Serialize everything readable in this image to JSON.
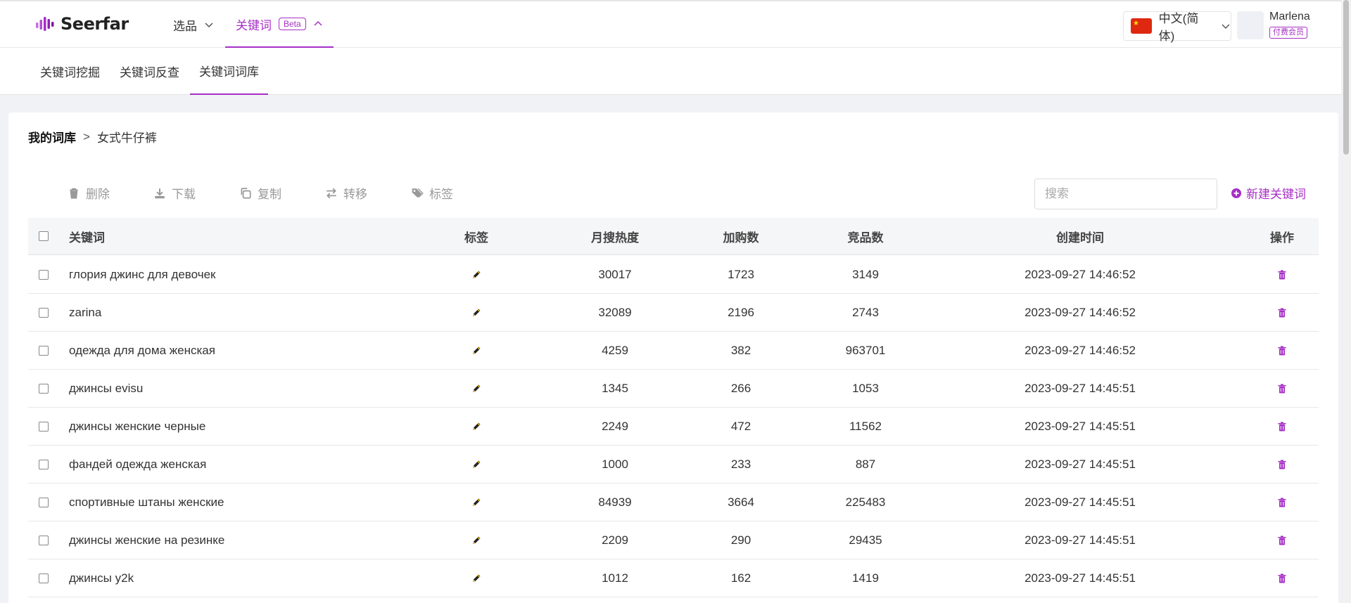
{
  "brand": {
    "name": "Seerfar",
    "accent": "#a62fc4"
  },
  "topnav": {
    "items": [
      {
        "label": "选品"
      },
      {
        "label": "关键词",
        "badge": "Beta"
      }
    ],
    "language": "中文(简体)",
    "user": {
      "name": "Marlena",
      "badge": "付费会员"
    }
  },
  "subnav": {
    "items": [
      {
        "label": "关键词挖掘"
      },
      {
        "label": "关键词反查"
      },
      {
        "label": "关键词词库"
      }
    ]
  },
  "breadcrumb": {
    "root": "我的词库",
    "separator": ">",
    "current": "女式牛仔裤"
  },
  "toolbar": {
    "delete": "删除",
    "download": "下载",
    "copy": "复制",
    "transfer": "转移",
    "tag": "标签",
    "search_placeholder": "搜索",
    "new_keyword": "新建关键词"
  },
  "table": {
    "headers": {
      "keyword": "关键词",
      "tags": "标签",
      "monthly_search": "月搜热度",
      "add_to_cart": "加购数",
      "competitors": "竞品数",
      "created": "创建时间",
      "actions": "操作"
    },
    "rows": [
      {
        "keyword": "глория джинс для девочек",
        "monthly_search": "30017",
        "add_to_cart": "1723",
        "competitors": "3149",
        "created": "2023-09-27 14:46:52"
      },
      {
        "keyword": "zarina",
        "monthly_search": "32089",
        "add_to_cart": "2196",
        "competitors": "2743",
        "created": "2023-09-27 14:46:52"
      },
      {
        "keyword": "одежда для дома женская",
        "monthly_search": "4259",
        "add_to_cart": "382",
        "competitors": "963701",
        "created": "2023-09-27 14:46:52"
      },
      {
        "keyword": "джинсы evisu",
        "monthly_search": "1345",
        "add_to_cart": "266",
        "competitors": "1053",
        "created": "2023-09-27 14:45:51"
      },
      {
        "keyword": "джинсы женские черные",
        "monthly_search": "2249",
        "add_to_cart": "472",
        "competitors": "11562",
        "created": "2023-09-27 14:45:51"
      },
      {
        "keyword": "фандей одежда женская",
        "monthly_search": "1000",
        "add_to_cart": "233",
        "competitors": "887",
        "created": "2023-09-27 14:45:51"
      },
      {
        "keyword": "спортивные штаны женские",
        "monthly_search": "84939",
        "add_to_cart": "3664",
        "competitors": "225483",
        "created": "2023-09-27 14:45:51"
      },
      {
        "keyword": "джинсы женские на резинке",
        "monthly_search": "2209",
        "add_to_cart": "290",
        "competitors": "29435",
        "created": "2023-09-27 14:45:51"
      },
      {
        "keyword": "джинсы y2k",
        "monthly_search": "1012",
        "add_to_cart": "162",
        "competitors": "1419",
        "created": "2023-09-27 14:45:51"
      }
    ]
  }
}
